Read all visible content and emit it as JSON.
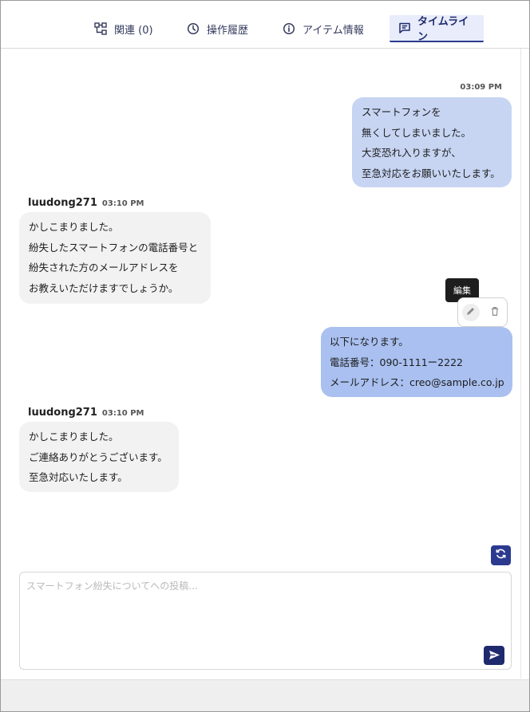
{
  "tabs": {
    "related": "関連 (0)",
    "history": "操作履歴",
    "info": "アイテム情報",
    "timeline": "タイムライン"
  },
  "messages": [
    {
      "time": "03:09 PM",
      "lines": [
        "スマートフォンを",
        "無くしてしまいました。",
        "大変恐れ入りますが、",
        "至急対応をお願いいたします。"
      ]
    },
    {
      "sender": "luudong271",
      "time": "03:10 PM",
      "lines": [
        "かしこまりました。",
        "紛失したスマートフォンの電話番号と",
        "紛失された方のメールアドレスを",
        "お教えいただけますでしょうか。"
      ]
    },
    {
      "lines": [
        "以下になります。",
        "電話番号：090-1111ー2222",
        "メールアドレス：creo@sample.co.jp"
      ]
    },
    {
      "sender": "luudong271",
      "time": "03:10 PM",
      "lines": [
        "かしこまりました。",
        "ご連絡ありがとうございます。",
        "至急対応いたします。"
      ]
    }
  ],
  "tooltip": "編集",
  "composer": {
    "placeholder": "スマートフォン紛失についてへの投稿...",
    "value": ""
  },
  "colors": {
    "accent": "#2b3a8f",
    "my_bubble": "#c7d5f3",
    "my_bubble_active": "#a9c0f0",
    "their_bubble": "#f2f2f2"
  },
  "icons": {
    "related": "relation-icon",
    "history": "clock-icon",
    "info": "info-icon",
    "timeline": "chat-icon",
    "edit": "pencil-icon",
    "delete": "trash-icon",
    "refresh": "refresh-icon",
    "send": "send-icon"
  }
}
